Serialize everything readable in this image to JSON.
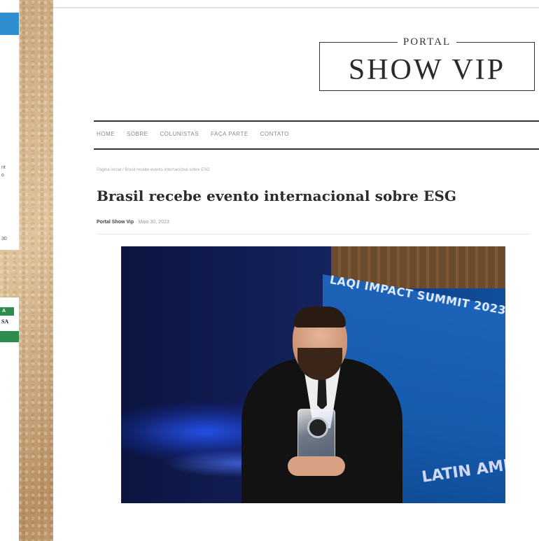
{
  "left_panel_top": {
    "lines": [
      "nt",
      "o",
      "30"
    ]
  },
  "left_panel_bottom": {
    "tag": "A",
    "text": "SA"
  },
  "site": {
    "logo_top": "PORTAL",
    "logo_main": "SHOW VIP"
  },
  "nav": {
    "items": [
      "HOME",
      "SOBRE",
      "COLUNISTAS",
      "FAÇA PARTE",
      "CONTATO"
    ]
  },
  "breadcrumb": "Página inicial / Brasil recebe evento internacional sobre ESG",
  "article": {
    "title": "Brasil recebe evento internacional sobre ESG",
    "author": "Portal Show Vip",
    "date": "Maio 30, 2023"
  },
  "photo": {
    "banner_text": "LAQI IMPACT SUMMIT 2023",
    "banner_bottom_text": "LATIN AMER"
  }
}
